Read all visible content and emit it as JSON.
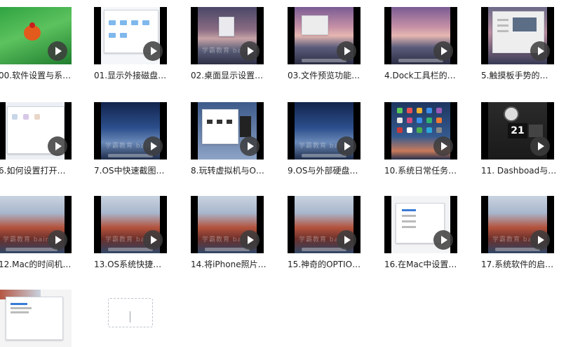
{
  "videos": [
    {
      "title": "00.软件设置与系…"
    },
    {
      "title": "01.显示外接磁盘…"
    },
    {
      "title": "02.桌面显示设置…"
    },
    {
      "title": "03.文件预览功能…"
    },
    {
      "title": "4.Dock工具栏的…"
    },
    {
      "title": "5.触摸板手势的…"
    },
    {
      "title": "6.如何设置打开…"
    },
    {
      "title": "7.OS中快速截图…"
    },
    {
      "title": "8.玩转虚拟机与O…"
    },
    {
      "title": "9.OS与外部硬盘…"
    },
    {
      "title": "10.系统日常任务…"
    },
    {
      "title": "11. Dashboad与…"
    },
    {
      "title": "12.Mac的时间机…"
    },
    {
      "title": "13.OS系统快捷…"
    },
    {
      "title": "14.将iPhone照片…"
    },
    {
      "title": "15.神奇的OPTIO…"
    },
    {
      "title": "16.在Mac中设置…"
    },
    {
      "title": "17.系统软件的启…"
    }
  ],
  "dashboard_date": "21",
  "watermark": "学霸教育 baing"
}
